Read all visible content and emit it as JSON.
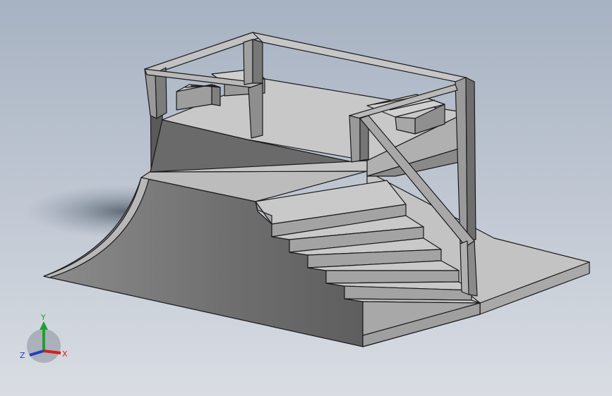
{
  "viewport": {
    "background_top": "#a7b2c2",
    "background_bottom": "#d9dde3",
    "model_face_light": "#bdbdbd",
    "model_face_mid": "#9a9a9a",
    "model_face_dark": "#666666",
    "edge_color": "#1a1a1a",
    "stair_step_count": 8,
    "bench_count": 2,
    "railings": [
      "top-left-guardrail",
      "top-right-guardrail",
      "stair-handrail"
    ]
  },
  "triad": {
    "x_label": "X",
    "y_label": "Y",
    "z_label": "Z",
    "x_color": "#d42020",
    "y_color": "#20a030",
    "z_color": "#2040c0"
  }
}
